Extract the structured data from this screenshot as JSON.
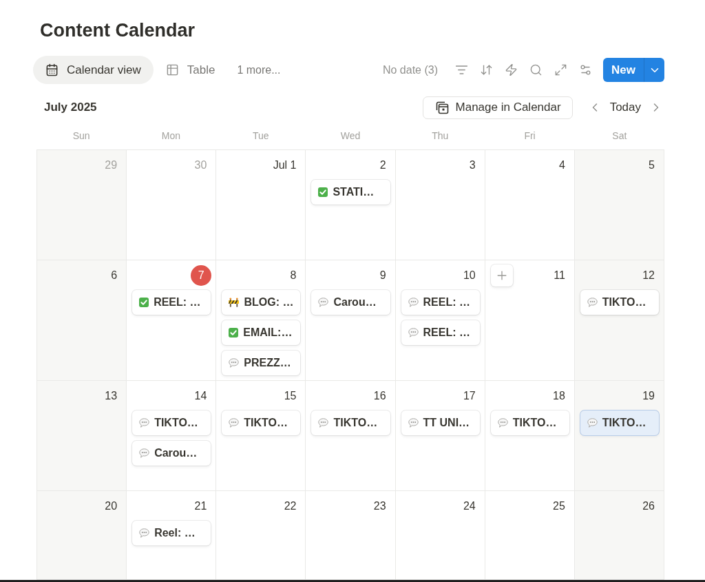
{
  "page": {
    "title": "Content Calendar"
  },
  "views": {
    "tabs": [
      {
        "label": "Calendar view",
        "kind": "calendar",
        "selected": true
      },
      {
        "label": "Table",
        "kind": "table",
        "selected": false
      }
    ],
    "more": "1 more..."
  },
  "toolbar": {
    "no_date": "No date (3)",
    "new_button": "New"
  },
  "calendar": {
    "month": "July 2025",
    "manage_button": "Manage in Calendar",
    "today_button": "Today",
    "weekdays": [
      "Sun",
      "Mon",
      "Tue",
      "Wed",
      "Thu",
      "Fri",
      "Sat"
    ],
    "weeks": [
      {
        "days": [
          {
            "label": "29",
            "outside_month": true,
            "today": false,
            "add_button": false
          },
          {
            "label": "30",
            "outside_month": true,
            "today": false,
            "add_button": false
          },
          {
            "label": "Jul 1",
            "outside_month": false,
            "today": false,
            "add_button": false
          },
          {
            "label": "2",
            "outside_month": false,
            "today": false,
            "add_button": false,
            "events": [
              {
                "title": "STATI…",
                "kind": "done",
                "selected": false
              }
            ]
          },
          {
            "label": "3",
            "outside_month": false,
            "today": false,
            "add_button": false
          },
          {
            "label": "4",
            "outside_month": false,
            "today": false,
            "add_button": false
          },
          {
            "label": "5",
            "outside_month": false,
            "today": false,
            "add_button": false
          }
        ]
      },
      {
        "days": [
          {
            "label": "6",
            "outside_month": false,
            "today": false,
            "add_button": false
          },
          {
            "label": "7",
            "outside_month": false,
            "today": true,
            "add_button": false,
            "events": [
              {
                "title": "REEL: …",
                "kind": "done",
                "selected": false
              }
            ]
          },
          {
            "label": "8",
            "outside_month": false,
            "today": false,
            "add_button": false,
            "events": [
              {
                "title": "BLOG: …",
                "kind": "blocked",
                "selected": false
              },
              {
                "title": "EMAIL:…",
                "kind": "done",
                "selected": false
              },
              {
                "title": "PREZZ…",
                "kind": "note",
                "selected": false
              }
            ]
          },
          {
            "label": "9",
            "outside_month": false,
            "today": false,
            "add_button": false,
            "events": [
              {
                "title": "Carou…",
                "kind": "note",
                "selected": false
              }
            ]
          },
          {
            "label": "10",
            "outside_month": false,
            "today": false,
            "add_button": false,
            "events": [
              {
                "title": "REEL: …",
                "kind": "note",
                "selected": false
              },
              {
                "title": "REEL: …",
                "kind": "note",
                "selected": false
              }
            ]
          },
          {
            "label": "11",
            "outside_month": false,
            "today": false,
            "add_button": true
          },
          {
            "label": "12",
            "outside_month": false,
            "today": false,
            "add_button": false,
            "events": [
              {
                "title": "TIKTO…",
                "kind": "note",
                "selected": false
              }
            ]
          }
        ]
      },
      {
        "days": [
          {
            "label": "13",
            "outside_month": false,
            "today": false,
            "add_button": false
          },
          {
            "label": "14",
            "outside_month": false,
            "today": false,
            "add_button": false,
            "events": [
              {
                "title": "TIKTO…",
                "kind": "note",
                "selected": false
              },
              {
                "title": "Carou…",
                "kind": "note",
                "selected": false
              }
            ]
          },
          {
            "label": "15",
            "outside_month": false,
            "today": false,
            "add_button": false,
            "events": [
              {
                "title": "TIKTO…",
                "kind": "note",
                "selected": false
              }
            ]
          },
          {
            "label": "16",
            "outside_month": false,
            "today": false,
            "add_button": false,
            "events": [
              {
                "title": "TIKTO…",
                "kind": "note",
                "selected": false
              }
            ]
          },
          {
            "label": "17",
            "outside_month": false,
            "today": false,
            "add_button": false,
            "events": [
              {
                "title": "TT UNI…",
                "kind": "note",
                "selected": false
              }
            ]
          },
          {
            "label": "18",
            "outside_month": false,
            "today": false,
            "add_button": false,
            "events": [
              {
                "title": "TIKTO…",
                "kind": "note",
                "selected": false
              }
            ]
          },
          {
            "label": "19",
            "outside_month": false,
            "today": false,
            "add_button": false,
            "events": [
              {
                "title": "TIKTO…",
                "kind": "note",
                "selected": true
              }
            ]
          }
        ]
      },
      {
        "days": [
          {
            "label": "20",
            "outside_month": false,
            "today": false,
            "add_button": false
          },
          {
            "label": "21",
            "outside_month": false,
            "today": false,
            "add_button": false,
            "events": [
              {
                "title": "Reel: …",
                "kind": "note",
                "selected": false
              }
            ]
          },
          {
            "label": "22",
            "outside_month": false,
            "today": false,
            "add_button": false
          },
          {
            "label": "23",
            "outside_month": false,
            "today": false,
            "add_button": false
          },
          {
            "label": "24",
            "outside_month": false,
            "today": false,
            "add_button": false
          },
          {
            "label": "25",
            "outside_month": false,
            "today": false,
            "add_button": false
          },
          {
            "label": "26",
            "outside_month": false,
            "today": false,
            "add_button": false
          }
        ]
      }
    ]
  }
}
